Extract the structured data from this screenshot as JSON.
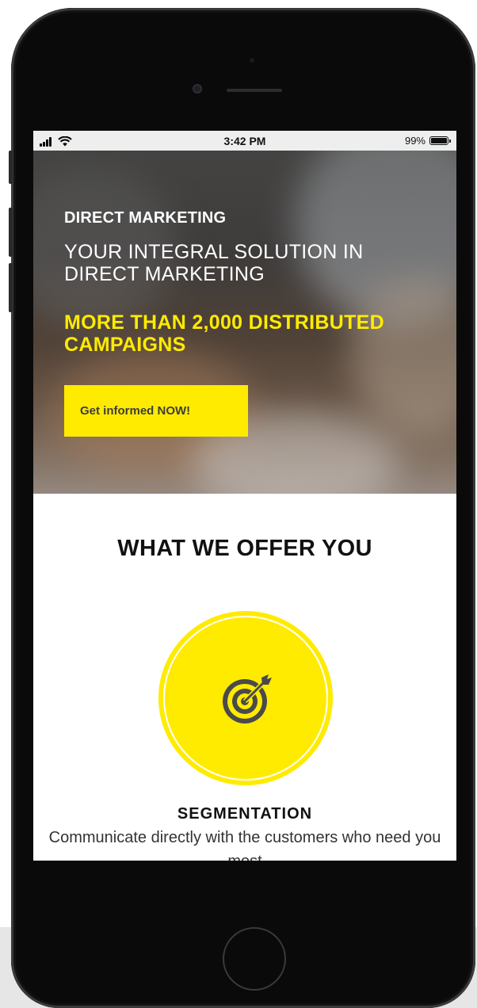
{
  "status_bar": {
    "time": "3:42 PM",
    "battery_percent": "99%",
    "battery_level": 0.99,
    "signal_icon": "cellular-signal-icon",
    "wifi_icon": "wifi-icon",
    "battery_icon": "battery-icon"
  },
  "hero": {
    "eyebrow": "DIRECT MARKETING",
    "title": "YOUR INTEGRAL SOLUTION IN DIRECT MARKETING",
    "highlight": "MORE THAN 2,000 DISTRIBUTED CAMPAIGNS",
    "cta_label": "Get informed NOW!"
  },
  "offer": {
    "section_title": "WHAT WE OFFER YOU",
    "feature": {
      "icon": "target-icon",
      "title": "SEGMENTATION",
      "description": "Communicate directly with the customers who need you most"
    }
  },
  "colors": {
    "accent": "#ffeb00",
    "hero_text": "#ffffff",
    "heading": "#111111",
    "body_text": "#333333"
  }
}
